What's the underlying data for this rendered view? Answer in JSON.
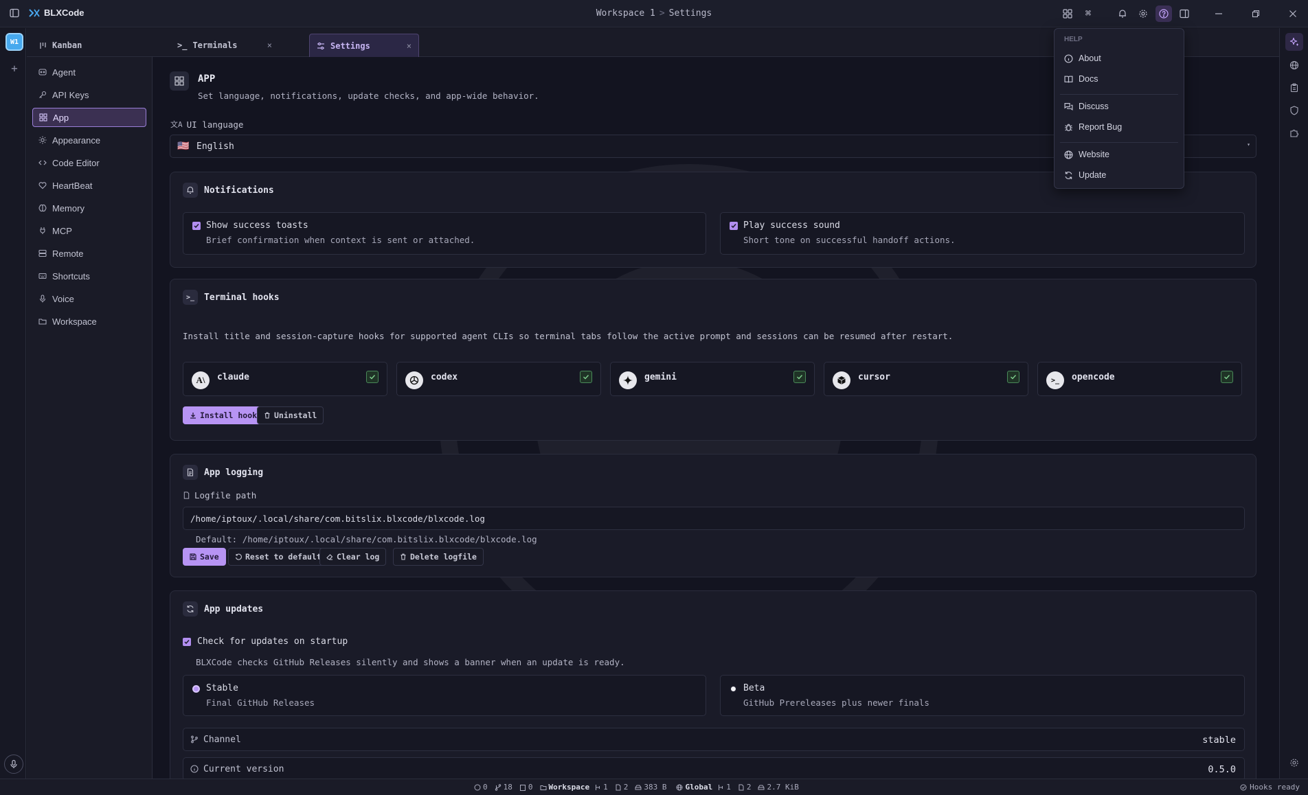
{
  "titlebar": {
    "app_name": "BLXCode",
    "workspace": "Workspace 1",
    "separator": ">",
    "page": "Settings"
  },
  "workspace_rail": {
    "badge": "W1",
    "add": "+"
  },
  "tabs": [
    {
      "label": "Kanban"
    },
    {
      "label": "Terminals",
      "close": "×"
    },
    {
      "label": "Settings",
      "close": "×"
    }
  ],
  "nav": {
    "items": [
      {
        "label": "Agent"
      },
      {
        "label": "API Keys"
      },
      {
        "label": "App"
      },
      {
        "label": "Appearance"
      },
      {
        "label": "Code Editor"
      },
      {
        "label": "HeartBeat"
      },
      {
        "label": "Memory"
      },
      {
        "label": "MCP"
      },
      {
        "label": "Remote"
      },
      {
        "label": "Shortcuts"
      },
      {
        "label": "Voice"
      },
      {
        "label": "Workspace"
      }
    ]
  },
  "app_header": {
    "title": "APP",
    "subtitle": "Set language, notifications, update checks, and app-wide behavior."
  },
  "ui_language": {
    "label": "UI language",
    "value": "English",
    "flag": "🇺🇸"
  },
  "notifications": {
    "title": "Notifications",
    "options": [
      {
        "title": "Show success toasts",
        "desc": "Brief confirmation when context is sent or attached.",
        "checked": true
      },
      {
        "title": "Play success sound",
        "desc": "Short tone on successful handoff actions.",
        "checked": true
      }
    ]
  },
  "terminal_hooks": {
    "title": "Terminal hooks",
    "desc": "Install title and session-capture hooks for supported agent CLIs so terminal tabs follow the active prompt and sessions can be resumed after restart.",
    "agents": [
      {
        "name": "claude",
        "checked": true
      },
      {
        "name": "codex",
        "checked": true
      },
      {
        "name": "gemini",
        "checked": true
      },
      {
        "name": "cursor",
        "checked": true
      },
      {
        "name": "opencode",
        "checked": true
      }
    ],
    "install_label": "Install hooks",
    "uninstall_label": "Uninstall"
  },
  "app_logging": {
    "title": "App logging",
    "path_label": "Logfile path",
    "path_value": "/home/iptoux/.local/share/com.bitslix.blxcode/blxcode.log",
    "default_text": "Default: /home/iptoux/.local/share/com.bitslix.blxcode/blxcode.log",
    "save_label": "Save",
    "reset_label": "Reset to default",
    "clear_label": "Clear log",
    "delete_label": "Delete logfile"
  },
  "app_updates": {
    "title": "App updates",
    "check_label": "Check for updates on startup",
    "check_checked": true,
    "desc": "BLXCode checks GitHub Releases silently and shows a banner when an update is ready.",
    "channels": [
      {
        "title": "Stable",
        "desc": "Final GitHub Releases",
        "selected": true
      },
      {
        "title": "Beta",
        "desc": "GitHub Prereleases plus newer finals",
        "selected": false
      }
    ],
    "channel_label": "Channel",
    "channel_value": "stable",
    "version_label": "Current version",
    "version_value": "0.5.0"
  },
  "help_menu": {
    "header": "HELP",
    "items": [
      {
        "label": "About"
      },
      {
        "label": "Docs"
      },
      {
        "label": "Discuss"
      },
      {
        "label": "Report Bug"
      },
      {
        "label": "Website"
      },
      {
        "label": "Update"
      }
    ]
  },
  "statusbar": {
    "errors": "0",
    "branches": "18",
    "tasks": "0",
    "workspace_label": "Workspace",
    "workspace_count": "1",
    "ws_docs": "2",
    "ws_size": "383 B",
    "global_label": "Global",
    "global_count": "1",
    "global_docs": "2",
    "global_size": "2.7 KiB",
    "hooks_status": "Hooks ready"
  },
  "colors": {
    "accent": "#b794f4",
    "background": "#131420",
    "card": "#1a1b28",
    "ws_badge": "#47a9ee",
    "check_green": "#4a8a5a"
  }
}
